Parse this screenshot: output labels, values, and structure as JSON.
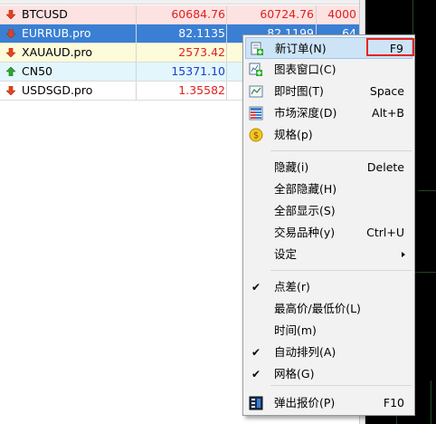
{
  "market_watch": {
    "rows": [
      {
        "symbol": "BTCUSD",
        "bid": "60684.76",
        "ask": "60724.76",
        "spread": "4000",
        "bg": "#fde2e2",
        "bid_color": "#e0201e",
        "ask_color": "#e0201e",
        "dir": "down",
        "selected": false
      },
      {
        "symbol": "EURRUB.pro",
        "bid": "82.1135",
        "ask": "82.1199",
        "spread": "64",
        "bg": "#3a7fd4",
        "bid_color": "#ffffff",
        "ask_color": "#ffffff",
        "dir": "down",
        "selected": true
      },
      {
        "symbol": "XAUAUD.pro",
        "bid": "2573.42",
        "ask": "",
        "spread": "",
        "bg": "#fdfbd9",
        "bid_color": "#e0201e",
        "ask_color": "#e0201e",
        "dir": "down",
        "selected": false
      },
      {
        "symbol": "CN50",
        "bid": "15371.10",
        "ask": "",
        "spread": "",
        "bg": "#e2f6fc",
        "bid_color": "#1a3ec8",
        "ask_color": "#1a3ec8",
        "dir": "up",
        "selected": false
      },
      {
        "symbol": "USDSGD.pro",
        "bid": "1.35582",
        "ask": "",
        "spread": "",
        "bg": "#ffffff",
        "bid_color": "#e0201e",
        "ask_color": "#e0201e",
        "dir": "down",
        "selected": false
      }
    ]
  },
  "context_menu": {
    "items": [
      {
        "label": "新订单(N)",
        "shortcut": "F9",
        "icon": "new-order-icon",
        "checked": false
      },
      {
        "label": "图表窗口(C)",
        "shortcut": "",
        "icon": "chart-window-icon",
        "checked": false
      },
      {
        "label": "即时图(T)",
        "shortcut": "Space",
        "icon": "tick-chart-icon",
        "checked": false
      },
      {
        "label": "市场深度(D)",
        "shortcut": "Alt+B",
        "icon": "market-depth-icon",
        "checked": false
      },
      {
        "label": "规格(p)",
        "shortcut": "",
        "icon": "specification-icon",
        "checked": false
      },
      {
        "label": "隐藏(i)",
        "shortcut": "Delete",
        "icon": "",
        "checked": false
      },
      {
        "label": "全部隐藏(H)",
        "shortcut": "",
        "icon": "",
        "checked": false
      },
      {
        "label": "全部显示(S)",
        "shortcut": "",
        "icon": "",
        "checked": false
      },
      {
        "label": "交易品种(y)",
        "shortcut": "Ctrl+U",
        "icon": "",
        "checked": false
      },
      {
        "label": "设定",
        "shortcut": "",
        "icon": "",
        "checked": false,
        "submenu": true
      },
      {
        "label": "点差(r)",
        "shortcut": "",
        "icon": "",
        "checked": true
      },
      {
        "label": "最高价/最低价(L)",
        "shortcut": "",
        "icon": "",
        "checked": false
      },
      {
        "label": "时间(m)",
        "shortcut": "",
        "icon": "",
        "checked": false
      },
      {
        "label": "自动排列(A)",
        "shortcut": "",
        "icon": "",
        "checked": true
      },
      {
        "label": "网格(G)",
        "shortcut": "",
        "icon": "",
        "checked": true
      },
      {
        "label": "弹出报价(P)",
        "shortcut": "F10",
        "icon": "popup-prices-icon",
        "checked": false
      }
    ],
    "check_glyph": "✔"
  }
}
